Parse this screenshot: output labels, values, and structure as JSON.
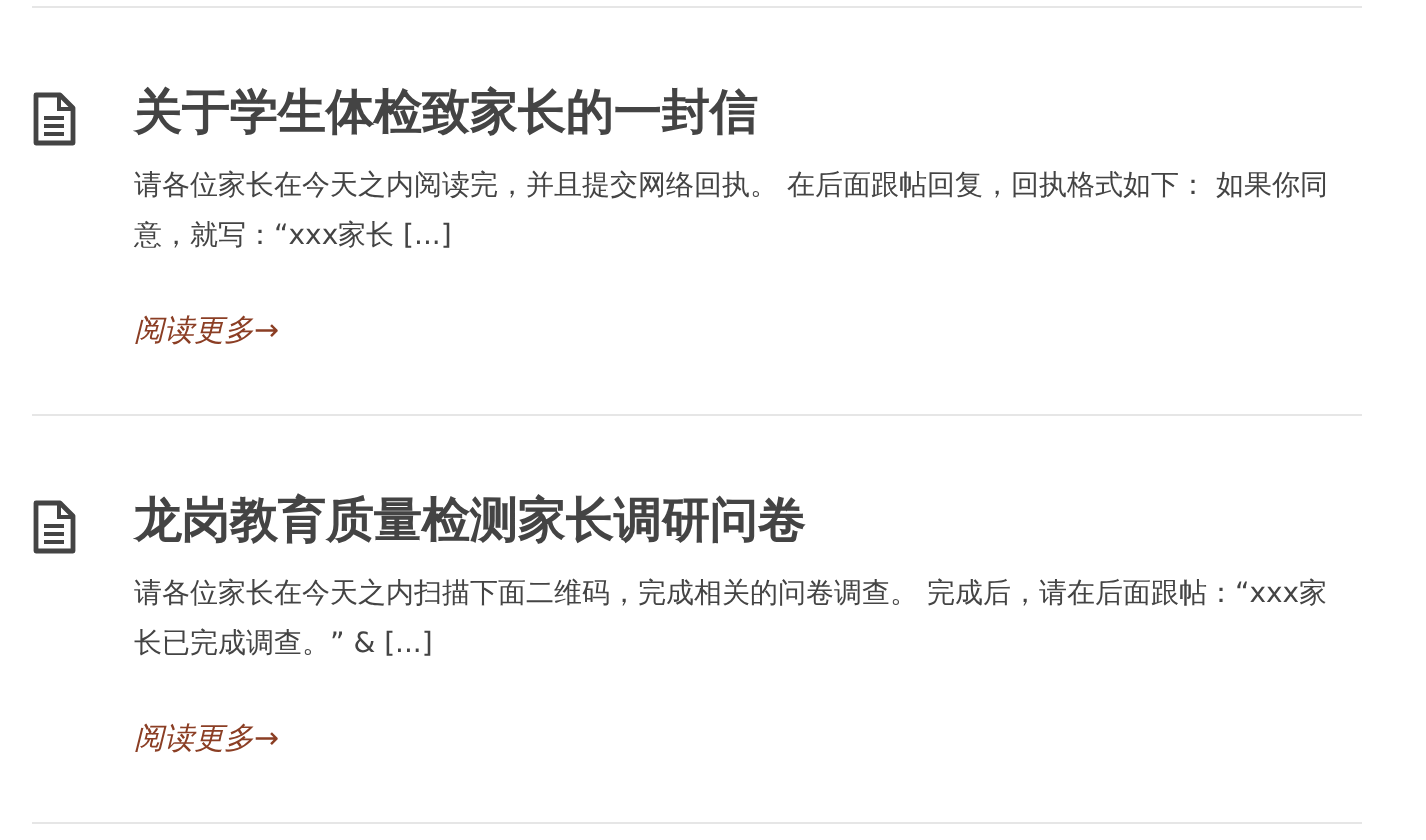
{
  "posts": [
    {
      "title": "关于学生体检致家长的一封信",
      "excerpt": "请各位家长在今天之内阅读完，并且提交网络回执。 在后面跟帖回复，回执格式如下： 如果你同意，就写：“xxx家长 [...]",
      "read_more": "阅读更多→"
    },
    {
      "title": "龙岗教育质量检测家长调研问卷",
      "excerpt": "请各位家长在今天之内扫描下面二维码，完成相关的问卷调查。 完成后，请在后面跟帖：“xxx家长已完成调查。” & [...]",
      "read_more": "阅读更多→"
    }
  ]
}
